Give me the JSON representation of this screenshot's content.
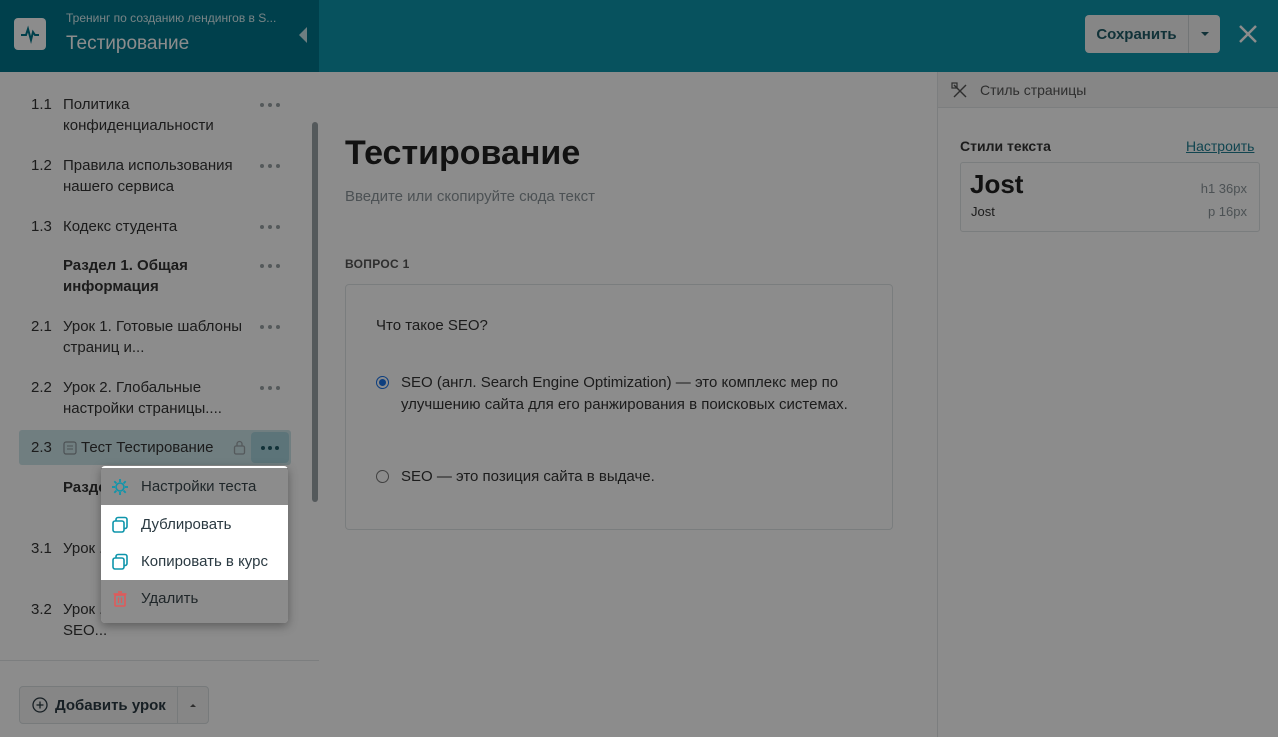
{
  "header": {
    "course_title": "Тренинг по созданию лендингов в S...",
    "page_name": "Тестирование",
    "save_label": "Сохранить"
  },
  "sidebar": {
    "items": [
      {
        "num": "1.1",
        "title": "Политика конфиденциальности"
      },
      {
        "num": "1.2",
        "title": "Правила использования нашего сервиса"
      },
      {
        "num": "1.3",
        "title": "Кодекс студента"
      },
      {
        "num": "",
        "title": "Раздел 1. Общая информация"
      },
      {
        "num": "2.1",
        "title": "Урок 1. Готовые шаблоны страниц и..."
      },
      {
        "num": "2.2",
        "title": "Урок 2. Глобальные настройки страницы...."
      },
      {
        "num": "2.3",
        "title": "Тест Тестирование"
      },
      {
        "num": "",
        "title": "Разде... стран..."
      },
      {
        "num": "3.1",
        "title": "Урок ... блок..."
      },
      {
        "num": "3.2",
        "title": "Урок ... готовой страницы, SEO..."
      }
    ],
    "add_lesson_label": "Добавить урок"
  },
  "context_menu": {
    "items": [
      {
        "label": "Настройки теста",
        "icon": "gear-icon"
      },
      {
        "label": "Дублировать",
        "icon": "duplicate-icon"
      },
      {
        "label": "Копировать в курс",
        "icon": "copy-to-course-icon"
      },
      {
        "label": "Удалить",
        "icon": "trash-icon"
      }
    ]
  },
  "content": {
    "title": "Тестирование",
    "subtitle": "Введите или скопируйте сюда текст",
    "question_label": "ВОПРОС 1",
    "question_text": "Что такое SEO?",
    "answers": [
      {
        "text": "SEO (англ. Search Engine Optimization) — это комплекс мер по улучшению сайта для его ранжирования в поисковых системах.",
        "selected": true
      },
      {
        "text": "SEO — это позиция сайта в выдаче.",
        "selected": false
      }
    ]
  },
  "right_panel": {
    "header_label": "Стиль страницы",
    "text_styles_label": "Стили текста",
    "configure_label": "Настроить",
    "h1_sample": "Jost",
    "p_sample": "Jost",
    "h1_meta": "h1  36px",
    "p_meta": "p  16px"
  },
  "colors": {
    "sidebar_header": "#00768a",
    "topbar": "#0e95ab",
    "accent": "#1f7f93",
    "radio_selected": "#1a73e8",
    "delete_icon": "#e05a5a"
  }
}
